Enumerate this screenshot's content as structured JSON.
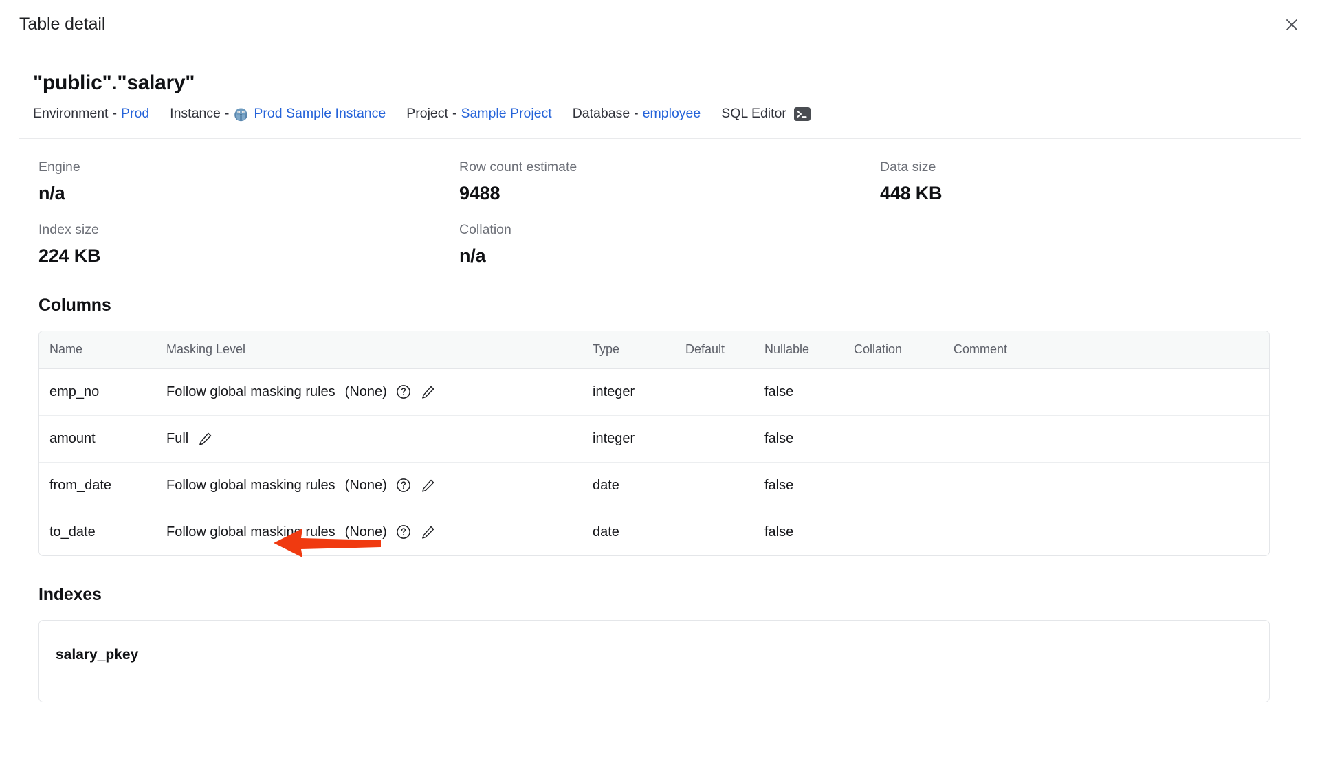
{
  "drawer": {
    "title": "Table detail",
    "close_icon": "close-icon"
  },
  "header": {
    "table_name": "\"public\".\"salary\"",
    "breadcrumb": [
      {
        "label": "Environment",
        "sep": "-",
        "link": "Prod",
        "icon": null
      },
      {
        "label": "Instance",
        "sep": "-",
        "link": "Prod Sample Instance",
        "icon": "postgres-icon"
      },
      {
        "label": "Project",
        "sep": "-",
        "link": "Sample Project",
        "icon": null
      },
      {
        "label": "Database",
        "sep": "-",
        "link": "employee",
        "icon": null
      }
    ],
    "sql_editor": {
      "label": "SQL Editor",
      "icon": "terminal-icon"
    }
  },
  "stats": [
    {
      "label": "Engine",
      "value": "n/a"
    },
    {
      "label": "Row count estimate",
      "value": "9488"
    },
    {
      "label": "Data size",
      "value": "448 KB"
    },
    {
      "label": "Index size",
      "value": "224 KB"
    },
    {
      "label": "Collation",
      "value": "n/a"
    }
  ],
  "columns_section": {
    "heading": "Columns",
    "headers": [
      "Name",
      "Masking Level",
      "Type",
      "Default",
      "Nullable",
      "Collation",
      "Comment"
    ],
    "rows": [
      {
        "name": "emp_no",
        "masking_level": "Follow global masking rules",
        "masking_detail": "(None)",
        "has_help_icon": true,
        "has_edit_icon": true,
        "type": "integer",
        "default": "",
        "nullable": "false",
        "collation": "",
        "comment": ""
      },
      {
        "name": "amount",
        "masking_level": "Full",
        "masking_detail": "",
        "has_help_icon": false,
        "has_edit_icon": true,
        "type": "integer",
        "default": "",
        "nullable": "false",
        "collation": "",
        "comment": ""
      },
      {
        "name": "from_date",
        "masking_level": "Follow global masking rules",
        "masking_detail": "(None)",
        "has_help_icon": true,
        "has_edit_icon": true,
        "type": "date",
        "default": "",
        "nullable": "false",
        "collation": "",
        "comment": ""
      },
      {
        "name": "to_date",
        "masking_level": "Follow global masking rules",
        "masking_detail": "(None)",
        "has_help_icon": true,
        "has_edit_icon": true,
        "type": "date",
        "default": "",
        "nullable": "false",
        "collation": "",
        "comment": ""
      }
    ]
  },
  "indexes_section": {
    "heading": "Indexes",
    "items": [
      {
        "name": "salary_pkey"
      }
    ]
  },
  "annotation": {
    "type": "arrow",
    "direction": "left",
    "color": "#F03A10",
    "points_at": "amount-masking-level-edit"
  },
  "colors": {
    "link": "#2563d9",
    "muted": "#6d7078",
    "border": "#e4e6e9",
    "header_bg": "#f7f9f9",
    "annotation_red": "#F03A10"
  }
}
